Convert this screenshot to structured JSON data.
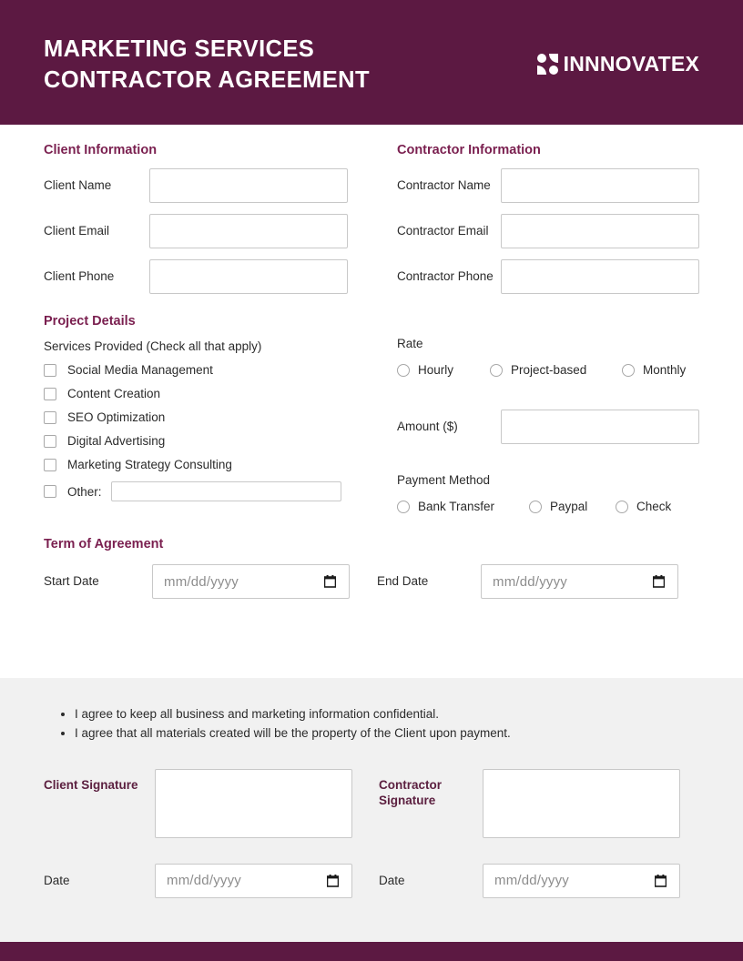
{
  "header": {
    "title": "MARKETING SERVICES\nCONTRACTOR AGREEMENT",
    "brand": "INNNOVATEX",
    "logo_icon": "four-petal-logo-mark",
    "bg_color": "#5C1942"
  },
  "theme": {
    "accent": "#7A1F4F",
    "header_bg": "#5C1942",
    "gray_band": "#F1F1F1",
    "input_border": "#C8C8C8"
  },
  "client_information": {
    "title": "Client Information",
    "fields": [
      {
        "label": "Client Name",
        "value": "",
        "placeholder": ""
      },
      {
        "label": "Client Email",
        "value": "",
        "placeholder": ""
      },
      {
        "label": "Client Phone",
        "value": "",
        "placeholder": ""
      }
    ]
  },
  "contractor_information": {
    "title": "Contractor Information",
    "fields": [
      {
        "label": "Contractor Name",
        "value": "",
        "placeholder": ""
      },
      {
        "label": "Contractor Email",
        "value": "",
        "placeholder": ""
      },
      {
        "label": "Contractor Phone",
        "value": "",
        "placeholder": ""
      }
    ]
  },
  "project_details": {
    "title": "Project Details",
    "services_hint": "Services Provided (Check all that apply)",
    "services": [
      {
        "label": "Social Media Management",
        "checked": false
      },
      {
        "label": "Content Creation",
        "checked": false
      },
      {
        "label": "SEO Optimization",
        "checked": false
      },
      {
        "label": "Digital Advertising",
        "checked": false
      },
      {
        "label": "Marketing Strategy Consulting",
        "checked": false
      }
    ],
    "other": {
      "label": "Other:",
      "checked": false,
      "value": "",
      "placeholder": ""
    }
  },
  "rate": {
    "label": "Rate",
    "options": [
      {
        "label": "Hourly",
        "selected": false
      },
      {
        "label": "Project-based",
        "selected": false
      },
      {
        "label": "Monthly",
        "selected": false
      }
    ],
    "amount": {
      "label": "Amount ($)",
      "value": "",
      "placeholder": ""
    }
  },
  "payment_method": {
    "label": "Payment Method",
    "options": [
      {
        "label": "Bank Transfer",
        "selected": false
      },
      {
        "label": "Paypal",
        "selected": false
      },
      {
        "label": "Check",
        "selected": false
      }
    ]
  },
  "term_of_agreement": {
    "title": "Term of Agreement",
    "start": {
      "label": "Start Date",
      "value": "",
      "placeholder": "mm/dd/yyyy"
    },
    "end": {
      "label": "End Date",
      "value": "",
      "placeholder": "mm/dd/yyyy"
    }
  },
  "agreement_terms": [
    "I agree to keep all business and marketing information confidential.",
    "I agree that all materials created will be the property of the Client upon payment."
  ],
  "signatures": {
    "client": {
      "label": "Client Signature",
      "value": "",
      "date_label": "Date",
      "date_value": "",
      "date_placeholder": "mm/dd/yyyy"
    },
    "contractor": {
      "label": "Contractor Signature",
      "value": "",
      "date_label": "Date",
      "date_value": "",
      "date_placeholder": "mm/dd/yyyy"
    }
  }
}
